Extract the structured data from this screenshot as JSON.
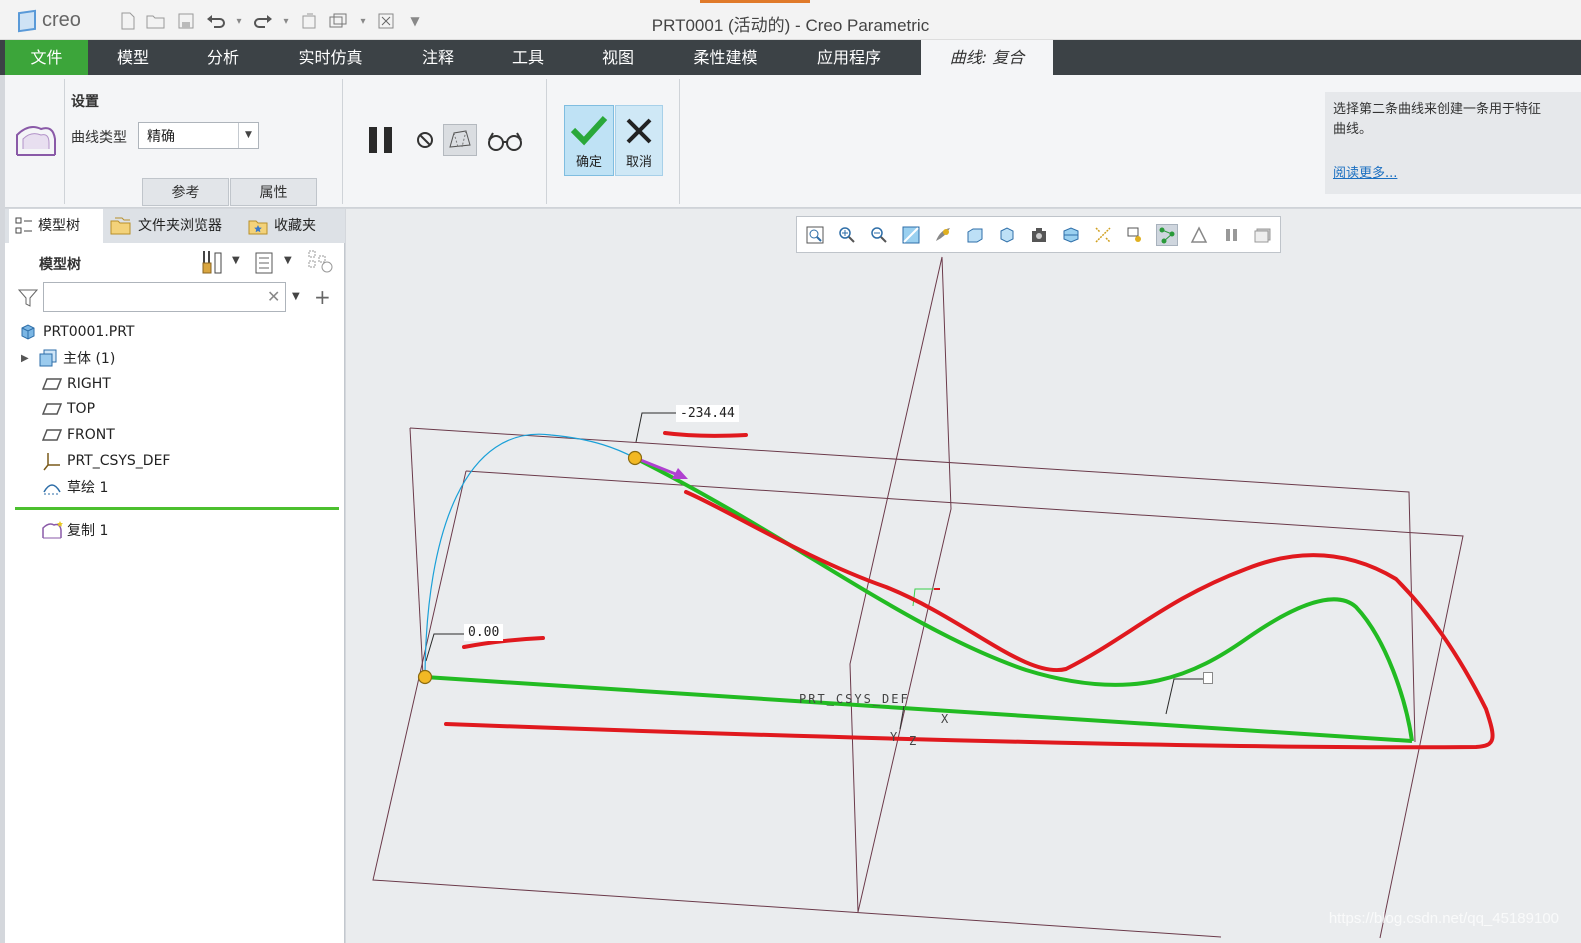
{
  "app": {
    "logo_text": "creo",
    "window_title": "PRT0001 (活动的) - Creo Parametric"
  },
  "ribbon_tabs": [
    "文件",
    "模型",
    "分析",
    "实时仿真",
    "注释",
    "工具",
    "视图",
    "柔性建模",
    "应用程序",
    "曲线: 复合"
  ],
  "ribbon": {
    "settings_title": "设置",
    "curve_type_label": "曲线类型",
    "curve_type_value": "精确",
    "subtabs": [
      "参考",
      "属性"
    ],
    "ok_label": "确定",
    "cancel_label": "取消",
    "hint_text": "选择第二条曲线来创建一条用于特征",
    "hint_text2": "曲线。",
    "hint_link": "阅读更多..."
  },
  "panel": {
    "tabs": [
      "模型树",
      "文件夹浏览器",
      "收藏夹"
    ],
    "tree_title": "模型树",
    "search_value": "",
    "tree": [
      {
        "label": "PRT0001.PRT",
        "icon": "part-icon"
      },
      {
        "label": "主体 (1)",
        "icon": "body-icon"
      },
      {
        "label": "RIGHT",
        "icon": "datum-plane-icon"
      },
      {
        "label": "TOP",
        "icon": "datum-plane-icon"
      },
      {
        "label": "FRONT",
        "icon": "datum-plane-icon"
      },
      {
        "label": "PRT_CSYS_DEF",
        "icon": "csys-icon"
      },
      {
        "label": "草绘 1",
        "icon": "sketch-icon"
      },
      {
        "label": "复制 1",
        "icon": "copy-curve-icon"
      }
    ]
  },
  "graphics": {
    "dim_start": "-234.44",
    "dim_end": "0.00",
    "csys_label": "PRT_CSYS_DEF",
    "axis_x": "X",
    "axis_y": "Y",
    "axis_z": "Z",
    "watermark": "https://blog.csdn.net/qq_45189100",
    "view_toolbar_icons": [
      "refit-icon",
      "zoom-in-icon",
      "zoom-out-icon",
      "repaint-icon",
      "display-style-icon",
      "saved-orientations-icon",
      "view-manager-icon",
      "perspective-icon",
      "section-icon",
      "datum-display-icon",
      "annotation-display-icon",
      "spin-center-icon",
      "simulation-display-icon",
      "pause-icon",
      "appearance-icon"
    ],
    "colors": {
      "composite_curve": "#22bb22",
      "annotation_marks": "#e0191e",
      "sketch_curve": "#1aa0d8",
      "datum_planes": "#6b3a4a"
    }
  }
}
